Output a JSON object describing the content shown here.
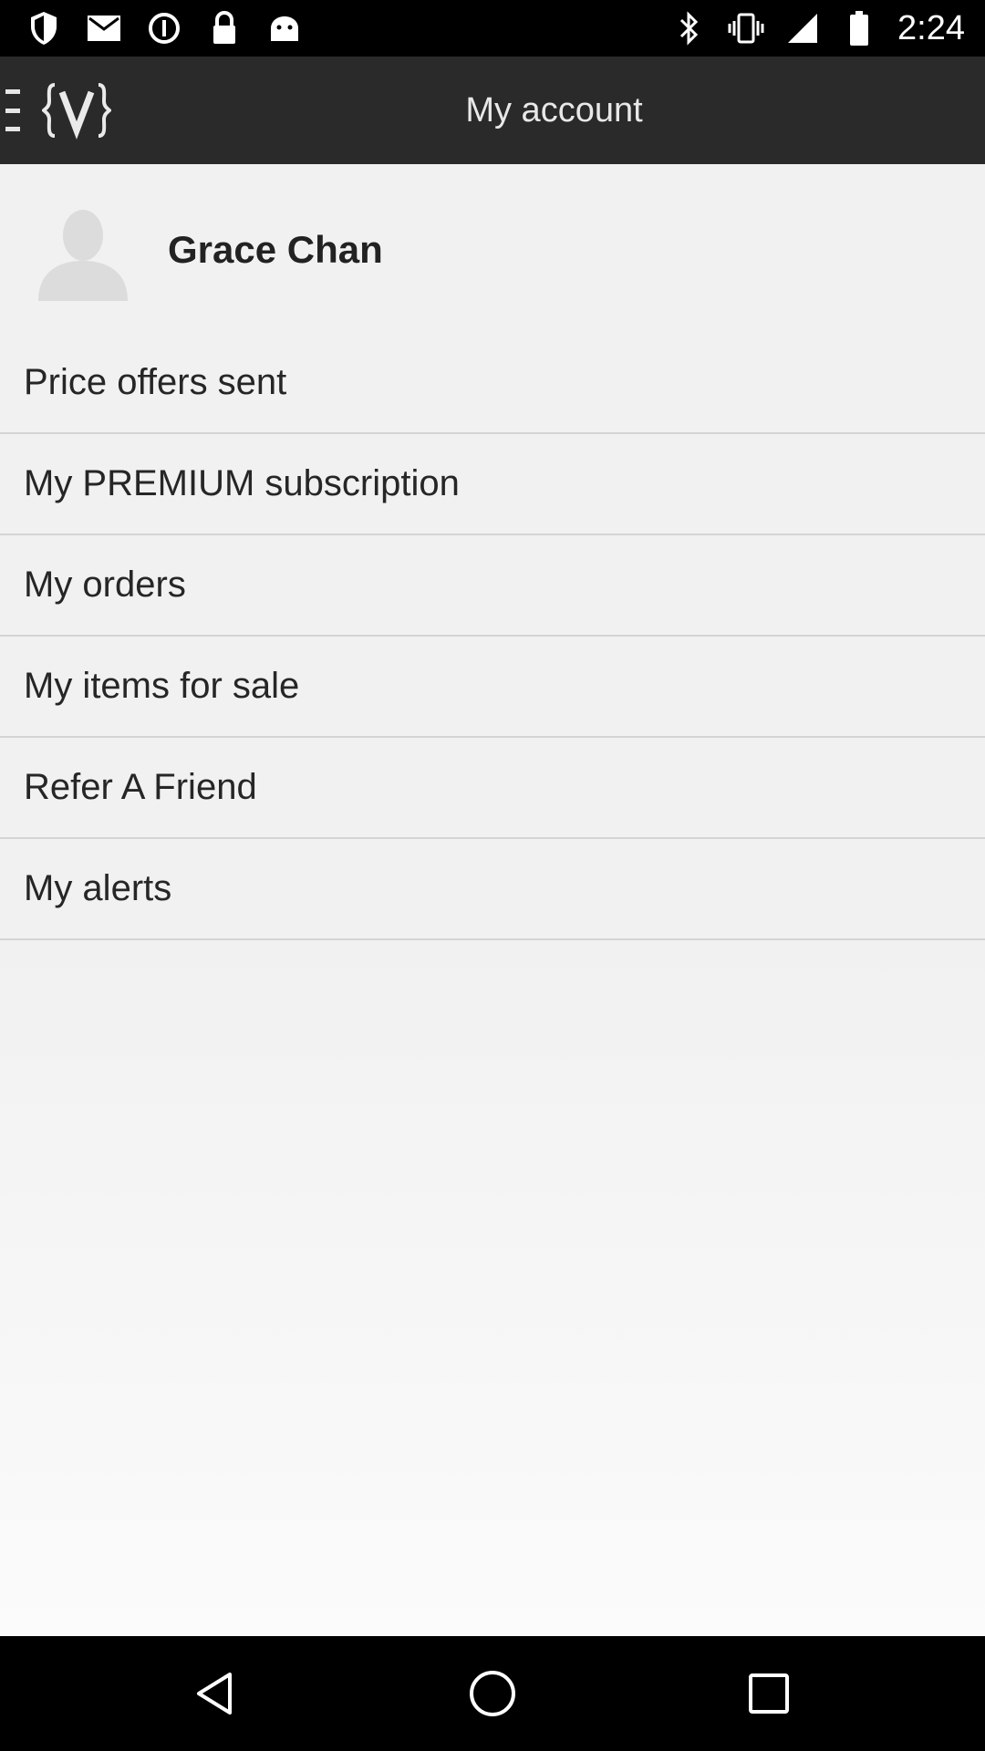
{
  "status_bar": {
    "time": "2:24",
    "left_icons": [
      "shield-icon",
      "mail-icon",
      "data-saver-icon",
      "lock-icon",
      "android-icon"
    ],
    "right_icons": [
      "bluetooth-icon",
      "vibrate-icon",
      "signal-icon",
      "battery-icon"
    ]
  },
  "app_bar": {
    "logo": "{V}",
    "title": "My account"
  },
  "profile": {
    "name": "Grace Chan"
  },
  "menu": {
    "items": [
      {
        "label": "Price offers sent"
      },
      {
        "label": "My PREMIUM subscription"
      },
      {
        "label": "My orders"
      },
      {
        "label": "My items for sale"
      },
      {
        "label": "Refer A Friend"
      },
      {
        "label": "My alerts"
      }
    ]
  },
  "nav_bar": {
    "buttons": [
      "back-icon",
      "home-icon",
      "recents-icon"
    ]
  }
}
